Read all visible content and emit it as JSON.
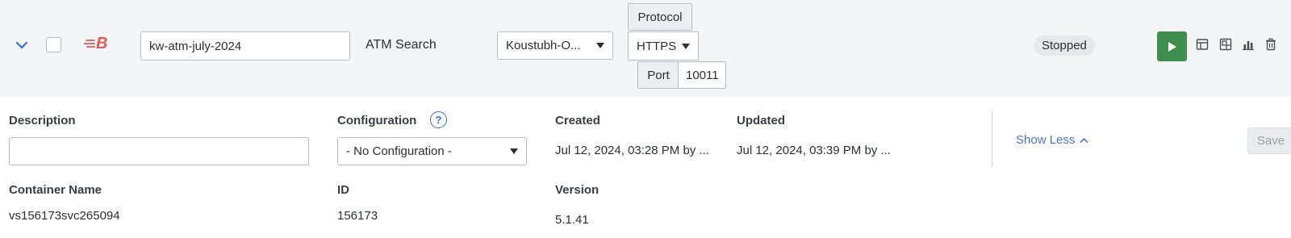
{
  "row": {
    "name_value": "kw-atm-july-2024",
    "type_text": "ATM Search",
    "user_select": "Koustubh-O...",
    "protocol_label": "Protocol",
    "protocol_value": "HTTPS",
    "port_label": "Port",
    "port_value": "10011",
    "status": "Stopped",
    "brand_letter": "B",
    "icons": [
      "chevron-down-icon",
      "brand-logo-icon",
      "play-icon",
      "table-view-icon",
      "dashboard-icon",
      "bar-chart-icon",
      "trash-icon"
    ]
  },
  "details": {
    "description_label": "Description",
    "description_value": "",
    "configuration_label": "Configuration",
    "configuration_help": "?",
    "configuration_value": "- No Configuration -",
    "created_label": "Created",
    "created_value": "Jul 12, 2024, 03:28 PM by ...",
    "updated_label": "Updated",
    "updated_value": "Jul 12, 2024, 03:39 PM by ...",
    "show_less": "Show Less",
    "save": "Save",
    "container_name_label": "Container Name",
    "container_name_value": "vs156173svc265094",
    "id_label": "ID",
    "id_value": "156173",
    "version_label": "Version",
    "version_value": "5.1.41"
  },
  "colors": {
    "row_background": "#f4f5f7",
    "accent_blue": "#3a6fd0",
    "play_green": "#3e8e4e",
    "brand_red": "#e05a57"
  }
}
